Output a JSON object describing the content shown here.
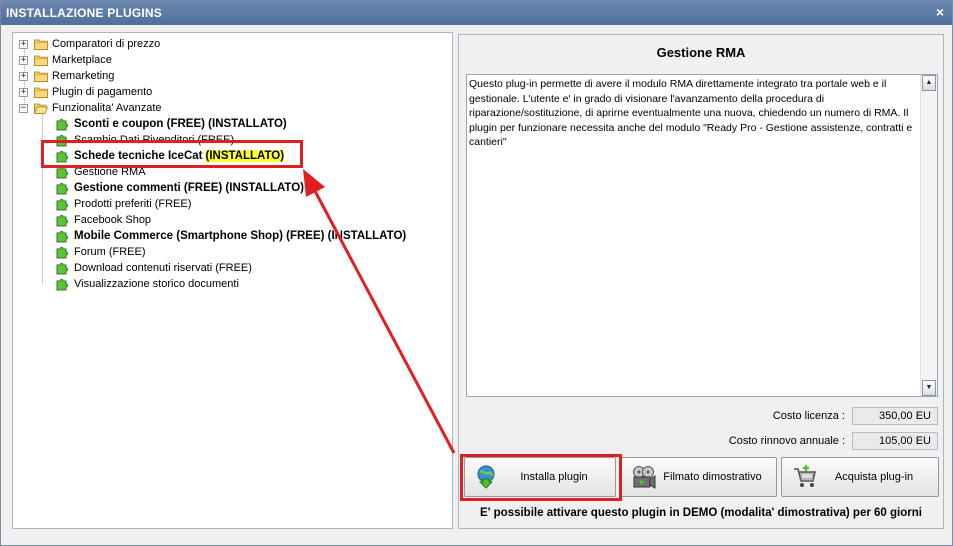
{
  "window": {
    "title": "INSTALLAZIONE PLUGINS",
    "close_label": "×"
  },
  "tree": {
    "categories": [
      {
        "label": "Comparatori di prezzo",
        "expander": "+"
      },
      {
        "label": "Marketplace",
        "expander": "+"
      },
      {
        "label": "Remarketing",
        "expander": "+"
      },
      {
        "label": "Plugin di pagamento",
        "expander": "+"
      },
      {
        "label": "Funzionalita' Avanzate",
        "expander": "−"
      }
    ],
    "plugins": [
      {
        "label": "Sconti e coupon (FREE) (INSTALLATO)",
        "bold": true
      },
      {
        "label": "Scambio Dati Rivenditori (FREE)",
        "bold": false
      },
      {
        "label": "Schede tecniche IceCat",
        "suffix": "(INSTALLATO)",
        "bold": true
      },
      {
        "label": "Gestione RMA",
        "bold": false
      },
      {
        "label": "Gestione commenti (FREE) (INSTALLATO)",
        "bold": true
      },
      {
        "label": "Prodotti preferiti (FREE)",
        "bold": false
      },
      {
        "label": "Facebook Shop",
        "bold": false
      },
      {
        "label": "Mobile Commerce (Smartphone Shop) (FREE) (INSTALLATO)",
        "bold": true
      },
      {
        "label": "Forum (FREE)",
        "bold": false
      },
      {
        "label": "Download contenuti riservati (FREE)",
        "bold": false
      },
      {
        "label": "Visualizzazione storico documenti",
        "bold": false
      }
    ]
  },
  "detail": {
    "title": "Gestione RMA",
    "description": "Questo plug-in permette di avere il modulo RMA direttamente integrato tra portale web e il gestionale. L'utente e' in grado di visionare l'avanzamento della procedura di riparazione/sostituzione, di aprirne eventualmente una nuova, chiedendo un numero di RMA. Il plugin per funzionare necessita anche del modulo \"Ready Pro - Gestione assistenze, contratti e cantieri\"",
    "scroll_up": "▲",
    "scroll_down": "▼",
    "license_cost_label": "Costo licenza :",
    "license_cost_value": "350,00 EU",
    "renewal_cost_label": "Costo rinnovo annuale :",
    "renewal_cost_value": "105,00 EU"
  },
  "buttons": {
    "install": "Installa plugin",
    "demo_video": "Filmato dimostrativo",
    "buy": "Acquista plug-in"
  },
  "demo_note": "E' possibile attivare questo plugin in DEMO (modalita' dimostrativa) per 60 giorni",
  "colors": {
    "annotation_red": "#e21f1f",
    "highlight_yellow": "#ffff33",
    "titlebar": "#5a7aa4"
  }
}
